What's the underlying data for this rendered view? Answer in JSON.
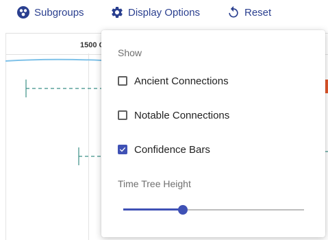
{
  "toolbar": {
    "subgroups_label": "Subgroups",
    "display_options_label": "Display Options",
    "reset_label": "Reset",
    "accent_color": "#2a3f8f"
  },
  "chart": {
    "ruler_label": "1500 CE"
  },
  "display_options": {
    "show_heading": "Show",
    "options": [
      {
        "label": "Ancient Connections",
        "checked": false
      },
      {
        "label": "Notable Connections",
        "checked": false
      },
      {
        "label": "Confidence Bars",
        "checked": true
      }
    ],
    "time_tree_height_heading": "Time Tree Height",
    "time_tree_height_value": 0.33,
    "accent_color": "#3f51b5"
  }
}
